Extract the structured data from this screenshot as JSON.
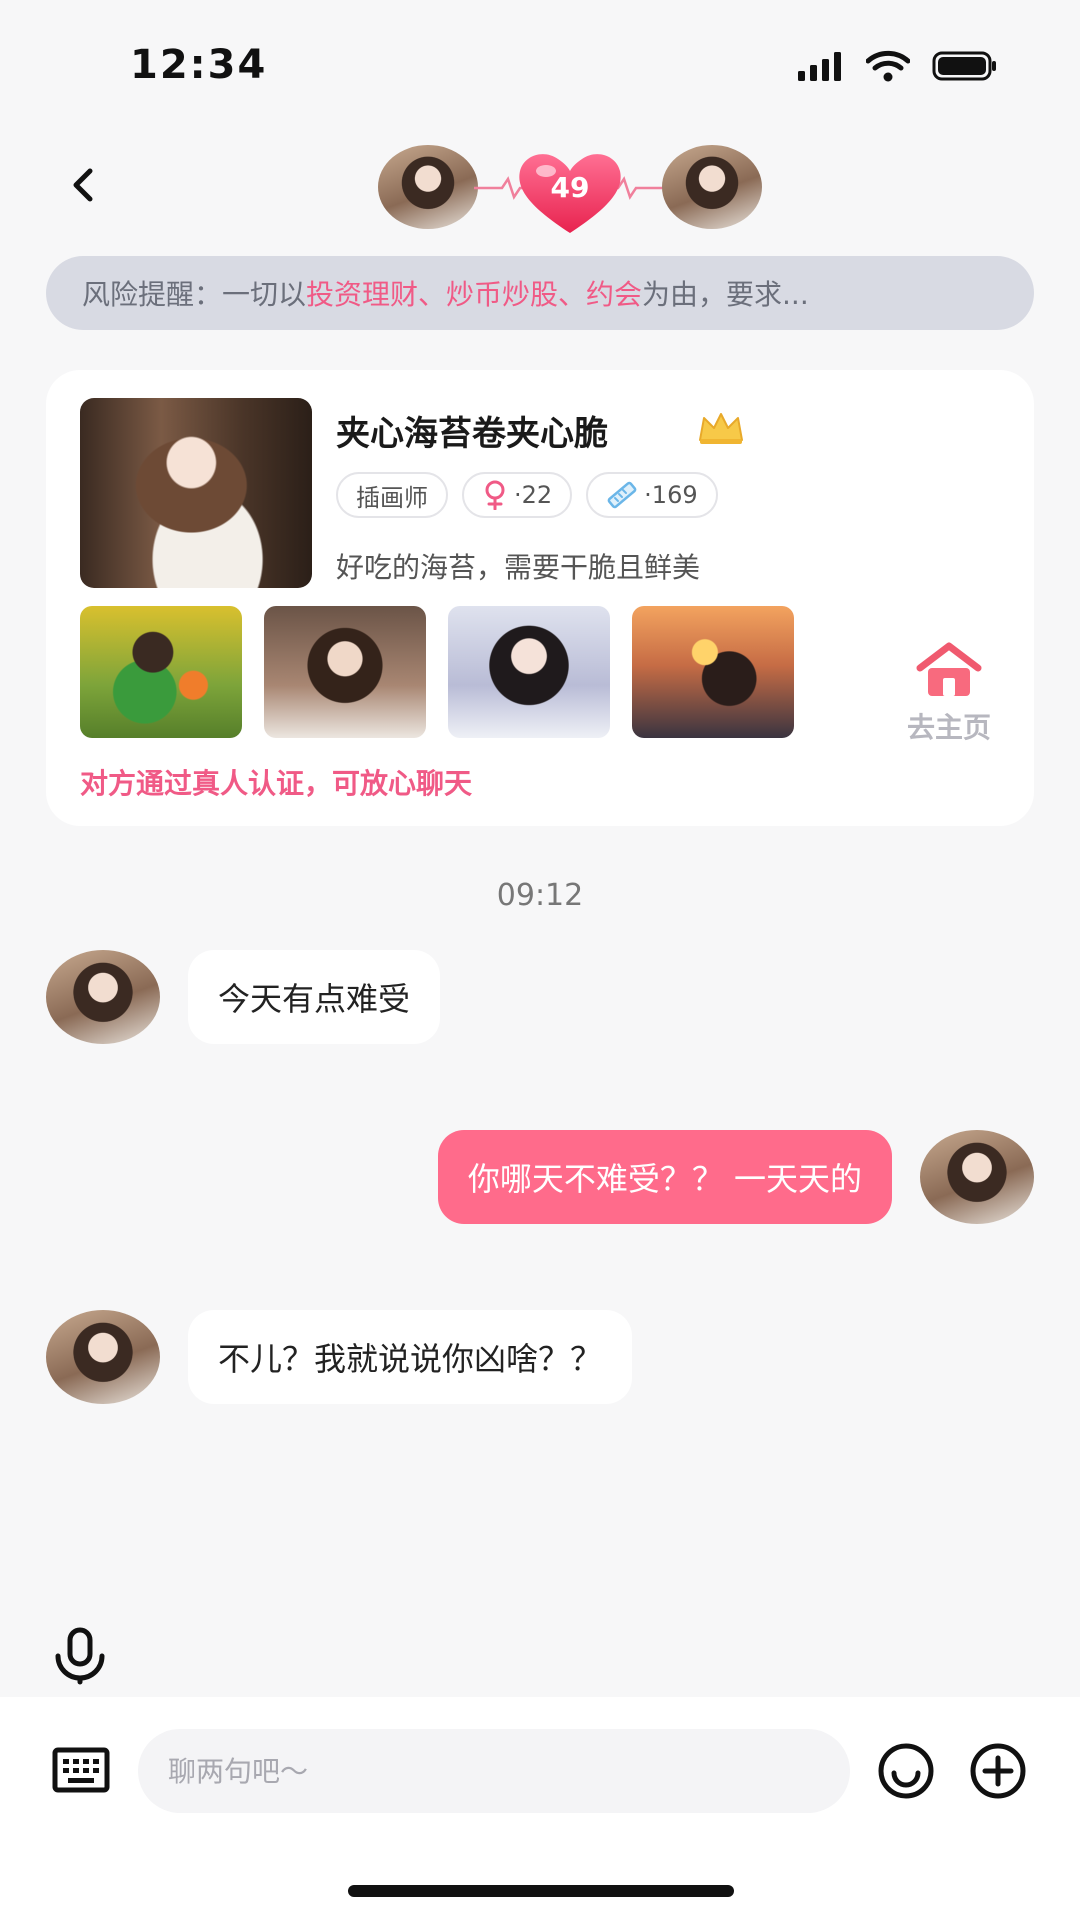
{
  "status_bar": {
    "time": "12:34"
  },
  "header": {
    "intimacy_value": "49"
  },
  "risk_banner": {
    "prefix": "风险提醒：一切以 ",
    "highlight": "投资理财、炒币炒股、约会",
    "suffix": " 为由，要求..."
  },
  "profile": {
    "name": "夹心海苔卷夹心脆",
    "tags": [
      {
        "label": "插画师"
      },
      {
        "label": "·22",
        "icon": "female-icon"
      },
      {
        "label": "·169",
        "icon": "ruler-icon"
      }
    ],
    "bio": "好吃的海苔，需要干脆且鲜美",
    "go_home_label": "去主页",
    "verify_text": "对方通过真人认证，可放心聊天"
  },
  "chat": {
    "time": "09:12",
    "messages": [
      {
        "direction": "in",
        "text": "今天有点难受"
      },
      {
        "direction": "out",
        "text": "你哪天不难受？？ 一天天的"
      },
      {
        "direction": "in",
        "text": "不儿？我就说说你凶啥？？"
      }
    ]
  },
  "input_bar": {
    "placeholder": "聊两句吧～"
  },
  "colors": {
    "accent": "#ff6b8b",
    "highlight": "#f05a86",
    "banner_bg": "#d8dae3"
  }
}
